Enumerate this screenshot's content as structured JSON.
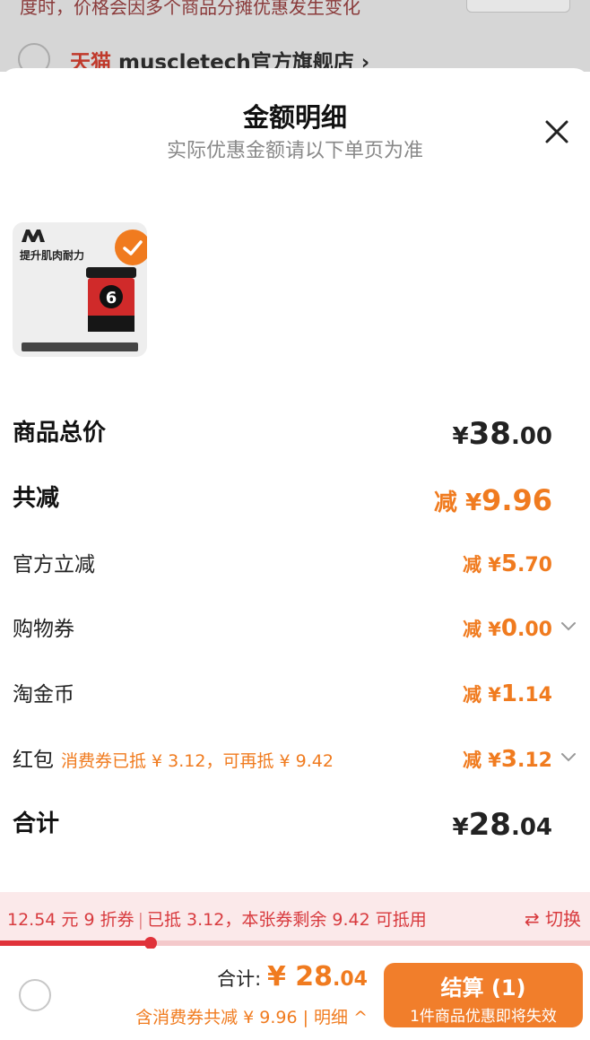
{
  "background": {
    "notice_text": "度时，价格会因多个商品分摊优惠发生变化",
    "shop_prefix": "天猫",
    "shop_name": "muscletech官方旗舰店",
    "shop_arrow": "›"
  },
  "sheet": {
    "title": "金额明细",
    "subtitle": "实际优惠金额请以下单页为准"
  },
  "product": {
    "image_text": "提升肌肉耐力",
    "selected": true,
    "check_mark": "✓"
  },
  "rows": [
    {
      "label": "商品总价",
      "prefix": "",
      "symbol": "¥",
      "int": "38",
      "dec": ".00",
      "note": ""
    },
    {
      "label": "共减",
      "prefix": "减 ",
      "symbol": "¥",
      "int": "9.96",
      "dec": "",
      "note": ""
    },
    {
      "label": "官方立减",
      "prefix": "减 ",
      "symbol": "¥",
      "int": "5",
      "dec": ".70",
      "note": ""
    },
    {
      "label": "购物券",
      "prefix": "减 ",
      "symbol": "¥",
      "int": "0",
      "dec": ".00",
      "note": ""
    },
    {
      "label": "淘金币",
      "prefix": "减 ",
      "symbol": "¥",
      "int": "1",
      "dec": ".14",
      "note": ""
    },
    {
      "label": "红包",
      "prefix": "减 ",
      "symbol": "¥",
      "int": "3",
      "dec": ".12",
      "note": "消费券已抵 ¥ 3.12，可再抵 ¥ 9.42"
    },
    {
      "label": "合计",
      "prefix": "",
      "symbol": "¥",
      "int": "28",
      "dec": ".04",
      "note": ""
    }
  ],
  "coupon_bar": {
    "coupon": "12.54 元 9 折券",
    "separator": "|",
    "status": "已抵 3.12，本张券剩余 9.42 可抵用",
    "switch_label": "⇄ 切换",
    "progress_fraction": 0.255
  },
  "footer": {
    "total_label": "合计: ",
    "total_symbol": "¥ ",
    "total_int": "28",
    "total_dec": ".04",
    "discount_text": "含消费券共减 ¥ 9.96 | ",
    "detail_label": "明细 ^",
    "checkout_label": "结算 (1)",
    "checkout_sub": "1件商品优惠即将失效"
  },
  "colors": {
    "accent_orange": "#f07b1f",
    "coupon_red": "#d83a3e",
    "checkout_bg": "#f17e2b"
  }
}
